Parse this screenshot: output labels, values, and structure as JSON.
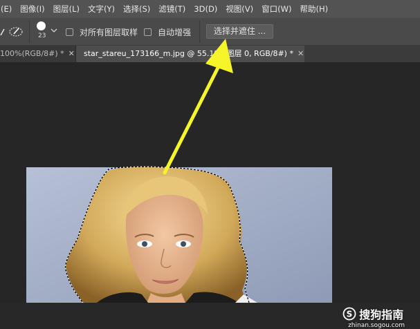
{
  "menu": {
    "items": [
      "(E)",
      "图像(I)",
      "图层(L)",
      "文字(Y)",
      "选择(S)",
      "滤镜(T)",
      "3D(D)",
      "视图(V)",
      "窗口(W)",
      "帮助(H)"
    ]
  },
  "options": {
    "brush_size": "23",
    "sample_all_layers_label": "对所有图层取样",
    "auto_enhance_label": "自动增强",
    "select_and_mask_label": "选择并遮住 ..."
  },
  "tabs": [
    {
      "label": "100%(RGB/8#) *",
      "active": false
    },
    {
      "label": "star_stareu_173166_m.jpg @ 55.1% (图层 0, RGB/8#) *",
      "active": true
    }
  ],
  "watermark": {
    "brand": "搜狗指南",
    "url": "zhinan.sogou.com"
  },
  "colors": {
    "menubar": "#535353",
    "optionsbar": "#4a4a4a",
    "canvas_bg": "#262626",
    "arrow": "#f5f52a"
  }
}
